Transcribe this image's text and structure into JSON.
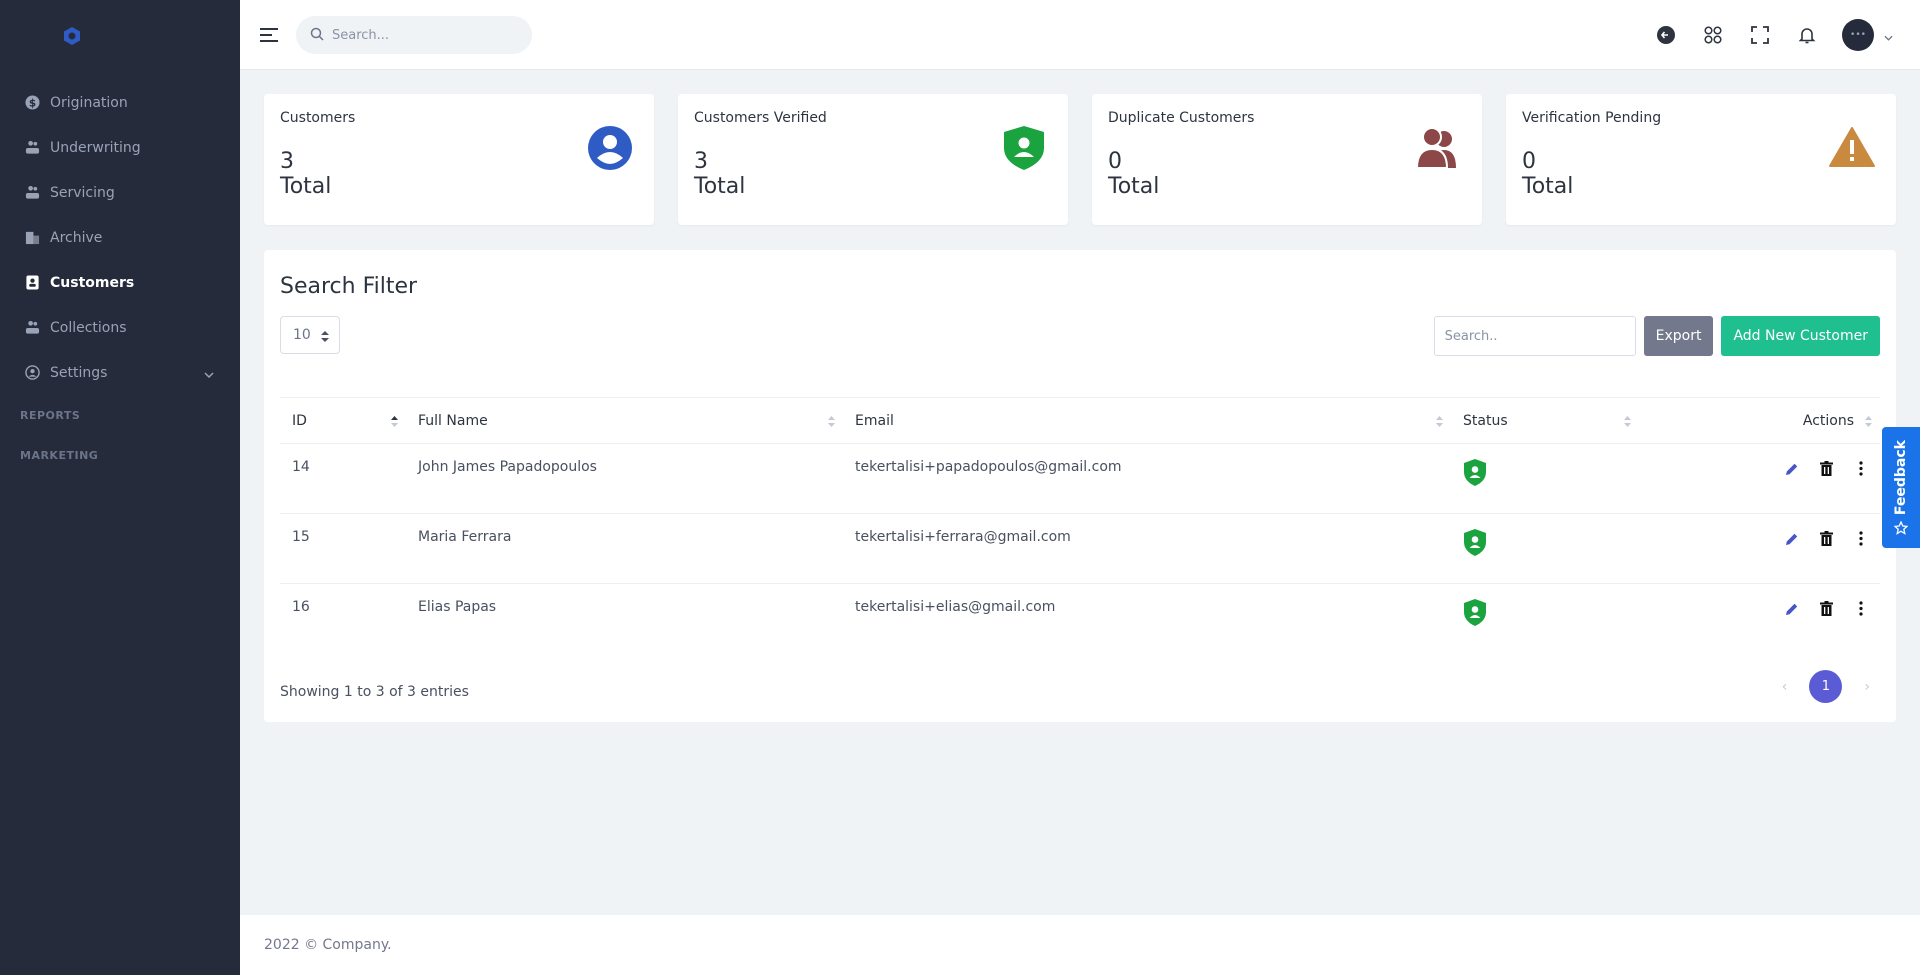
{
  "sidebar": {
    "items": [
      {
        "label": "Origination",
        "icon": "dollar-circle-icon"
      },
      {
        "label": "Underwriting",
        "icon": "hand-users-icon"
      },
      {
        "label": "Servicing",
        "icon": "hand-users-icon"
      },
      {
        "label": "Archive",
        "icon": "building-icon"
      },
      {
        "label": "Customers",
        "icon": "contact-card-icon",
        "active": true
      },
      {
        "label": "Collections",
        "icon": "hand-users-icon"
      },
      {
        "label": "Settings",
        "icon": "user-circle-icon",
        "expandable": true
      }
    ],
    "sections": [
      "REPORTS",
      "MARKETING"
    ]
  },
  "topbar": {
    "search_placeholder": "Search..."
  },
  "cards": [
    {
      "label": "Customers",
      "value": "3",
      "unit": "Total",
      "icon": "user-circle-icon",
      "color": "#2f5cc4"
    },
    {
      "label": "Customers Verified",
      "value": "3",
      "unit": "Total",
      "icon": "shield-user-icon",
      "color": "#1aa33f"
    },
    {
      "label": "Duplicate Customers",
      "value": "0",
      "unit": "Total",
      "icon": "users-icon",
      "color": "#8c4848"
    },
    {
      "label": "Verification Pending",
      "value": "0",
      "unit": "Total",
      "icon": "warning-triangle-icon",
      "color": "#c98a3f"
    }
  ],
  "panel": {
    "title": "Search Filter",
    "page_length": "10",
    "search_placeholder": "Search..",
    "export_label": "Export",
    "add_label": "Add New Customer",
    "columns": [
      "ID",
      "Full Name",
      "Email",
      "Status",
      "Actions"
    ],
    "rows": [
      {
        "id": "14",
        "name": "John James Papadopoulos",
        "email": "tekertalisi+papadopoulos@gmail.com",
        "status": "verified"
      },
      {
        "id": "15",
        "name": "Maria Ferrara",
        "email": "tekertalisi+ferrara@gmail.com",
        "status": "verified"
      },
      {
        "id": "16",
        "name": "Elias Papas",
        "email": "tekertalisi+elias@gmail.com",
        "status": "verified"
      }
    ],
    "entries_text": "Showing 1 to 3 of 3 entries",
    "pagination": {
      "prev": "‹",
      "current": "1",
      "next": "›"
    }
  },
  "footer": {
    "text": "2022 © Company."
  },
  "feedback": {
    "label": "Feedback"
  },
  "colors": {
    "sidebar_bg": "#252b3b",
    "accent": "#5b5bd6",
    "success": "#1fbf8f",
    "verified": "#1aa33f",
    "feedback": "#1a73e8"
  }
}
